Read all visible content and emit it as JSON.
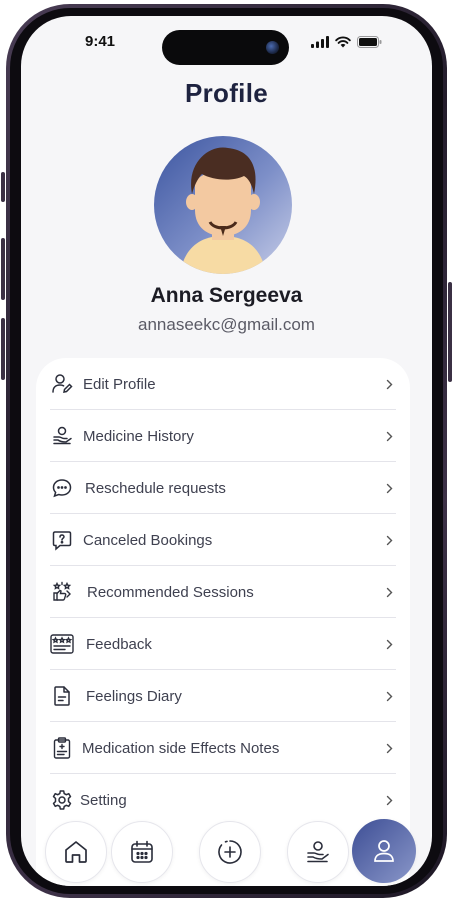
{
  "status_bar": {
    "time": "9:41"
  },
  "profile": {
    "title": "Profile",
    "name": "Anna Sergeeva",
    "email": "annaseekc@gmail.com"
  },
  "menu": {
    "items": [
      {
        "label": "Edit Profile",
        "icon": "user-edit-icon"
      },
      {
        "label": "Medicine History",
        "icon": "hand-pill-icon"
      },
      {
        "label": "Reschedule requests",
        "icon": "chat-bubble-icon"
      },
      {
        "label": "Canceled Bookings",
        "icon": "question-bubble-icon"
      },
      {
        "label": "Recommended Sessions",
        "icon": "recommendation-icon"
      },
      {
        "label": "Feedback",
        "icon": "rating-stars-icon"
      },
      {
        "label": "Feelings Diary",
        "icon": "document-icon"
      },
      {
        "label": "Medication side Effects Notes",
        "icon": "clipboard-icon"
      },
      {
        "label": "Setting",
        "icon": "gear-icon"
      }
    ]
  },
  "tabbar": {
    "tabs": [
      {
        "icon": "home-icon"
      },
      {
        "icon": "calendar-icon"
      },
      {
        "icon": "add-circle-icon"
      },
      {
        "icon": "hand-pill-icon"
      },
      {
        "icon": "profile-icon",
        "active": true
      }
    ]
  },
  "colors": {
    "title": "#1e2340",
    "accent": "#3d4e95",
    "screen_bg": "#f6f6f8",
    "card_bg": "#ffffff"
  }
}
